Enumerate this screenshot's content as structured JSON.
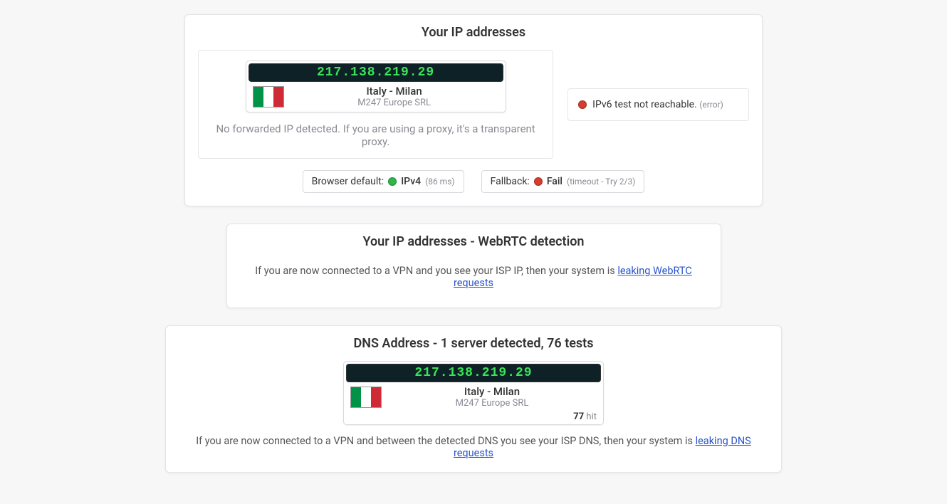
{
  "section1": {
    "title": "Your IP addresses",
    "ip": "217.138.219.29",
    "location": "Italy - Milan",
    "isp": "M247 Europe SRL",
    "proxy_note": "No forwarded IP detected. If you are using a proxy, it's a transparent proxy.",
    "ipv6_status": "IPv6 test not reachable.",
    "ipv6_status_meta": "(error)",
    "browser_default_label": "Browser default:",
    "browser_default_value": "IPv4",
    "browser_default_meta": "(86 ms)",
    "fallback_label": "Fallback:",
    "fallback_value": "Fail",
    "fallback_meta": "(timeout - Try 2/3)"
  },
  "section2": {
    "title": "Your IP addresses - WebRTC detection",
    "desc_prefix": "If you are now connected to a VPN and you see your ISP IP, then your system is ",
    "desc_link": "leaking WebRTC requests"
  },
  "section3": {
    "title": "DNS Address - 1 server detected, 76 tests",
    "ip": "217.138.219.29",
    "location": "Italy - Milan",
    "isp": "M247 Europe SRL",
    "hit_count": "77",
    "hit_label": "hit",
    "desc_prefix": "If you are now connected to a VPN and between the detected DNS you see your ISP DNS, then your system is ",
    "desc_link": "leaking DNS requests"
  }
}
